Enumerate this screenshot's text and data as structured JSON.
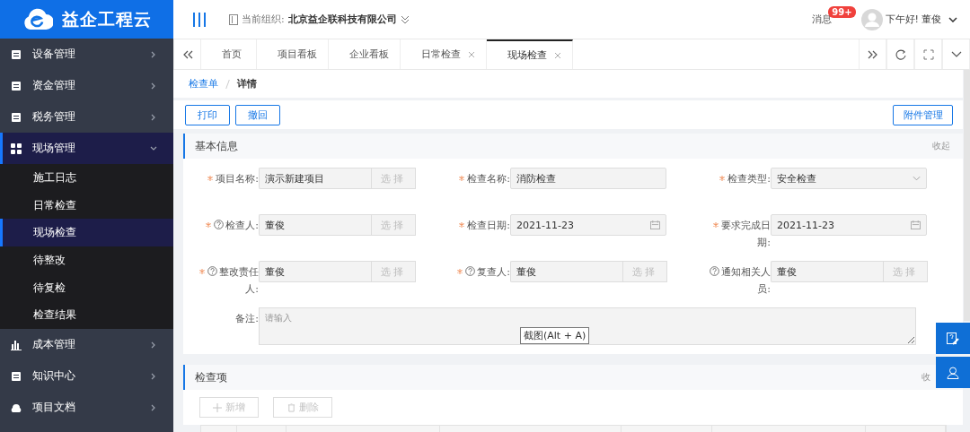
{
  "logo": {
    "text": "益企工程云"
  },
  "header": {
    "org_label": "当前组织:",
    "org_name": "北京益企联科技有限公司",
    "messages_label": "消息",
    "messages_badge": "99+",
    "greeting": "下午好!",
    "user": "董俊"
  },
  "sidebar": {
    "items": [
      {
        "label": "设备管理",
        "expanded": false
      },
      {
        "label": "资金管理",
        "expanded": false
      },
      {
        "label": "税务管理",
        "expanded": false
      },
      {
        "label": "现场管理",
        "expanded": true,
        "children": [
          {
            "label": "施工日志",
            "selected": false
          },
          {
            "label": "日常检查",
            "selected": false
          },
          {
            "label": "现场检查",
            "selected": true
          },
          {
            "label": "待整改",
            "selected": false
          },
          {
            "label": "待复检",
            "selected": false
          },
          {
            "label": "检查结果",
            "selected": false
          }
        ]
      },
      {
        "label": "成本管理",
        "expanded": false
      },
      {
        "label": "知识中心",
        "expanded": false
      },
      {
        "label": "项目文档",
        "expanded": false
      }
    ]
  },
  "tabs": [
    {
      "label": "首页",
      "selected": false,
      "closable": false
    },
    {
      "label": "项目看板",
      "selected": false,
      "closable": false
    },
    {
      "label": "企业看板",
      "selected": false,
      "closable": false
    },
    {
      "label": "日常检查",
      "selected": false,
      "closable": true
    },
    {
      "label": "现场检查",
      "selected": true,
      "closable": true
    }
  ],
  "breadcrumb": [
    "检查单",
    "详情"
  ],
  "toolbar": {
    "buttons": [
      "打印",
      "撤回"
    ],
    "right_button": "附件管理"
  },
  "basic_info": {
    "title": "基本信息",
    "toggle": "收起",
    "fields": [
      {
        "label": "项目名称:",
        "required": true,
        "help": false,
        "kind": "select",
        "value": "演示新建项目",
        "button": "选择"
      },
      {
        "label": "检查名称:",
        "required": true,
        "help": false,
        "kind": "text",
        "value": "消防检查"
      },
      {
        "label": "检查类型:",
        "required": true,
        "help": false,
        "kind": "dropdown",
        "value": "安全检查"
      },
      {
        "label": "检查人:",
        "required": true,
        "help": true,
        "kind": "select",
        "value": "董俊",
        "button": "选择"
      },
      {
        "label": "检查日期:",
        "required": true,
        "help": false,
        "kind": "date",
        "value": "2021-11-23"
      },
      {
        "label": "要求完成日期:",
        "required": true,
        "help": false,
        "kind": "date",
        "value": "2021-11-23"
      },
      {
        "label": "整改责任人:",
        "required": true,
        "help": true,
        "kind": "select",
        "value": "董俊",
        "button": "选择"
      },
      {
        "label": "复查人:",
        "required": true,
        "help": true,
        "kind": "select",
        "value": "董俊",
        "button": "选择"
      },
      {
        "label": "通知相关人员:",
        "required": false,
        "help": true,
        "kind": "select",
        "value": "董俊",
        "button": "选择"
      },
      {
        "label": "备注:",
        "required": false,
        "help": false,
        "kind": "textarea",
        "placeholder": "请输入"
      }
    ]
  },
  "tooltip": "截图(Alt + A)",
  "check_items": {
    "title": "检查项",
    "toggle": "收",
    "buttons": [
      {
        "label": "新增",
        "kind": "add",
        "disabled": true
      },
      {
        "label": "删除",
        "kind": "delete",
        "disabled": true
      }
    ]
  }
}
